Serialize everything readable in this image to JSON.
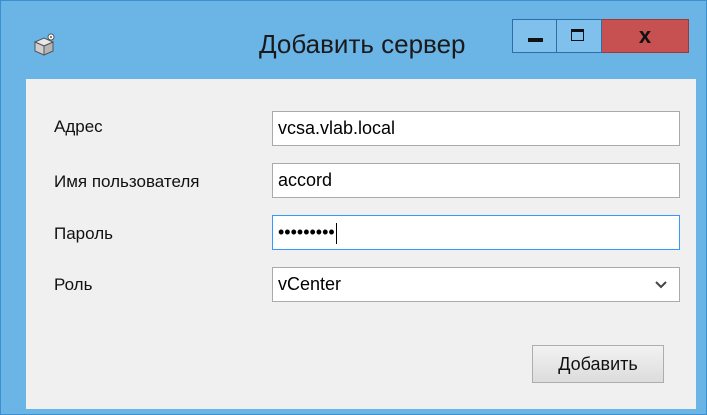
{
  "window": {
    "title": "Добавить сервер",
    "icon": "app-package-icon",
    "controls": {
      "minimize": "minimize-icon",
      "maximize": "maximize-icon",
      "close_glyph": "x"
    }
  },
  "form": {
    "address": {
      "label": "Адрес",
      "value": "vcsa.vlab.local"
    },
    "username": {
      "label": "Имя пользователя",
      "value": "accord"
    },
    "password": {
      "label": "Пароль",
      "value": "•••••••••"
    },
    "role": {
      "label": "Роль",
      "value": "vCenter",
      "icon": "chevron-down-icon"
    }
  },
  "actions": {
    "add_label": "Добавить"
  },
  "colors": {
    "frame": "#6bb4e6",
    "client": "#f0f0f0",
    "close": "#c75050",
    "focus": "#3399ff"
  }
}
